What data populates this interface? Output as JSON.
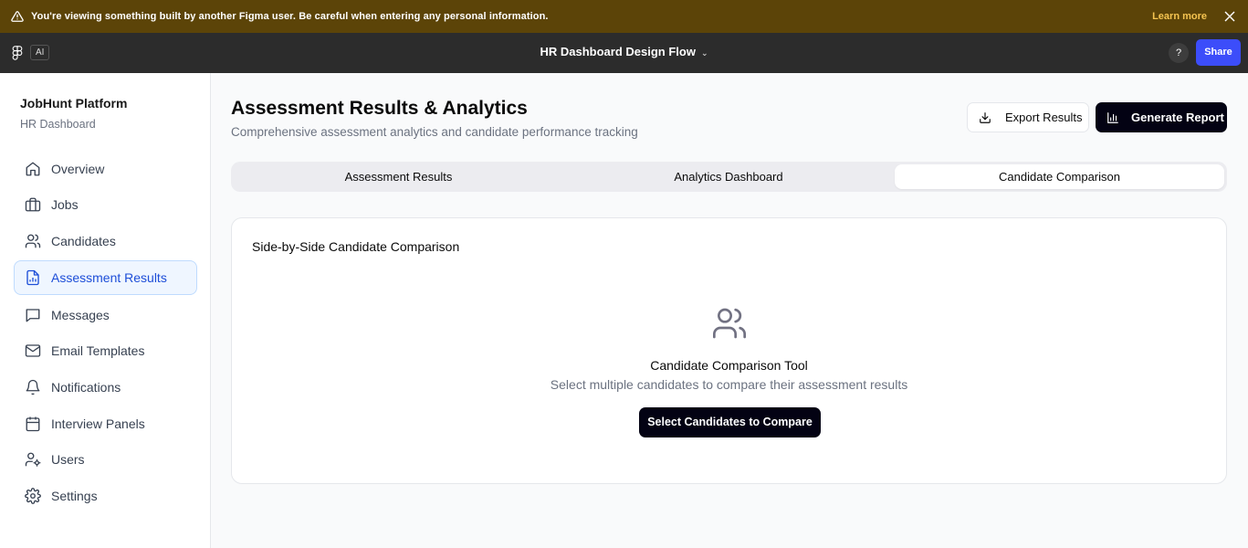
{
  "banner": {
    "text": "You're viewing something built by another Figma user. Be careful when entering any personal information.",
    "learn_more": "Learn more"
  },
  "figma": {
    "ai_label": "AI",
    "file_title": "HR Dashboard Design Flow",
    "help": "?",
    "share": "Share"
  },
  "sidebar": {
    "brand": "JobHunt Platform",
    "subtitle": "HR Dashboard",
    "items": [
      {
        "label": "Overview",
        "icon": "home-icon"
      },
      {
        "label": "Jobs",
        "icon": "briefcase-icon"
      },
      {
        "label": "Candidates",
        "icon": "users-icon"
      },
      {
        "label": "Assessment Results",
        "icon": "file-chart-icon",
        "active": true
      },
      {
        "label": "Messages",
        "icon": "message-icon"
      },
      {
        "label": "Email Templates",
        "icon": "mail-icon"
      },
      {
        "label": "Notifications",
        "icon": "bell-icon"
      },
      {
        "label": "Interview Panels",
        "icon": "calendar-icon"
      },
      {
        "label": "Users",
        "icon": "user-cog-icon"
      },
      {
        "label": "Settings",
        "icon": "gear-icon"
      }
    ]
  },
  "header": {
    "title": "Assessment Results & Analytics",
    "subtitle": "Comprehensive assessment analytics and candidate performance tracking",
    "export_label": "Export Results",
    "report_label": "Generate Report"
  },
  "tabs": [
    {
      "label": "Assessment Results"
    },
    {
      "label": "Analytics Dashboard"
    },
    {
      "label": "Candidate Comparison",
      "active": true
    }
  ],
  "comparison": {
    "title": "Side-by-Side Candidate Comparison",
    "empty_title": "Candidate Comparison Tool",
    "empty_subtitle": "Select multiple candidates to compare their assessment results",
    "button_label": "Select Candidates to Compare"
  },
  "colors": {
    "banner_bg": "#5c4408",
    "accent_link": "#f5c451",
    "share_bg": "#3c4dfa",
    "primary_button": "#030213",
    "active_nav_bg": "#eff6ff",
    "active_nav_text": "#1d4ed8"
  }
}
